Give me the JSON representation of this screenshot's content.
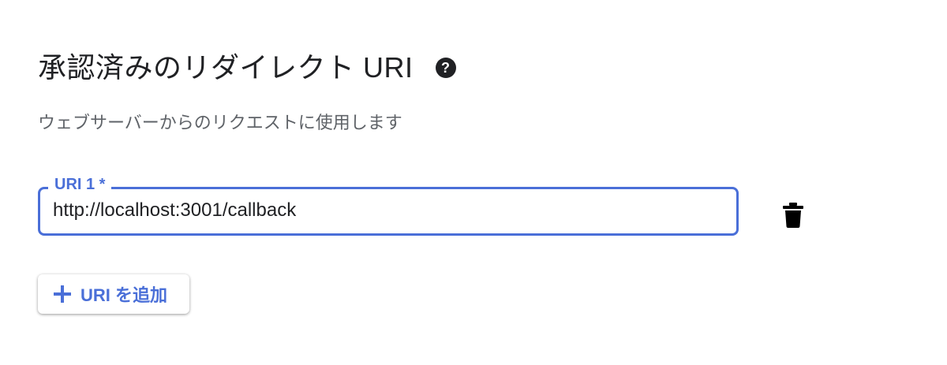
{
  "section": {
    "title": "承認済みのリダイレクト URI",
    "help_icon": "help-circle-icon",
    "description": "ウェブサーバーからのリクエストに使用します"
  },
  "uri_field": {
    "label": "URI 1 *",
    "value": "http://localhost:3001/callback",
    "delete_icon": "trash-icon"
  },
  "add_button": {
    "icon": "plus-icon",
    "label": "URI を追加"
  },
  "colors": {
    "accent": "#4a6fd8",
    "heading_text": "#202124",
    "secondary_text": "#5f6368"
  }
}
